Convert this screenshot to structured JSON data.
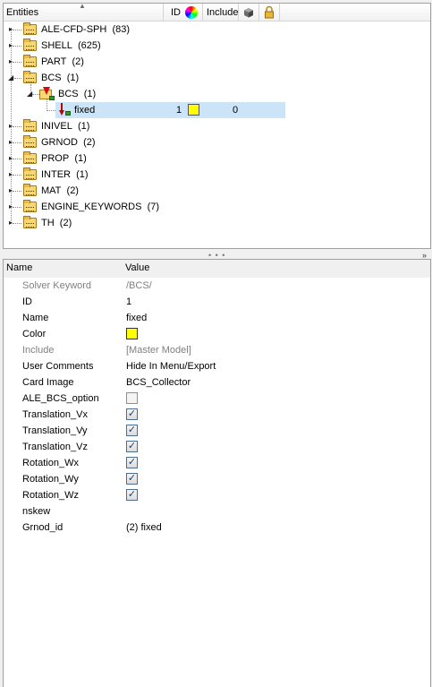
{
  "tree": {
    "columns": {
      "entities": "Entities",
      "id": "ID",
      "include": "Include"
    },
    "color_wheel_icon": "color-wheel-icon",
    "visibility_icon": "cube-icon",
    "lock_icon": "lock-icon",
    "items": [
      {
        "label": "ALE-CFD-SPH",
        "count": "(83)"
      },
      {
        "label": "SHELL",
        "count": "(625)"
      },
      {
        "label": "PART",
        "count": "(2)"
      },
      {
        "label": "BCS",
        "count": "(1)"
      },
      {
        "label": "BCS",
        "count": "(1)"
      },
      {
        "label": "fixed",
        "id": "1",
        "include": "0"
      },
      {
        "label": "INIVEL",
        "count": "(1)"
      },
      {
        "label": "GRNOD",
        "count": "(2)"
      },
      {
        "label": "PROP",
        "count": "(1)"
      },
      {
        "label": "INTER",
        "count": "(1)"
      },
      {
        "label": "MAT",
        "count": "(2)"
      },
      {
        "label": "ENGINE_KEYWORDS",
        "count": "(7)"
      },
      {
        "label": "TH",
        "count": "(2)"
      }
    ],
    "selected_color": "#ffff00"
  },
  "splitter": {
    "dots": "• • •",
    "chevron": "»"
  },
  "props": {
    "name_header": "Name",
    "value_header": "Value",
    "rows": [
      {
        "name": "Solver Keyword",
        "value": "/BCS/"
      },
      {
        "name": "ID",
        "value": "1"
      },
      {
        "name": "Name",
        "value": "fixed"
      },
      {
        "name": "Color",
        "value": "#ffff00"
      },
      {
        "name": "Include",
        "value": "[Master Model]"
      },
      {
        "name": "User Comments",
        "value": "Hide In Menu/Export"
      },
      {
        "name": "Card Image",
        "value": "BCS_Collector"
      },
      {
        "name": "ALE_BCS_option",
        "value": "unchecked"
      },
      {
        "name": "Translation_Vx",
        "value": "checked"
      },
      {
        "name": "Translation_Vy",
        "value": "checked"
      },
      {
        "name": "Translation_Vz",
        "value": "checked"
      },
      {
        "name": "Rotation_Wx",
        "value": "checked"
      },
      {
        "name": "Rotation_Wy",
        "value": "checked"
      },
      {
        "name": "Rotation_Wz",
        "value": "checked"
      },
      {
        "name": "nskew",
        "value": ""
      },
      {
        "name": "Grnod_id",
        "value": "(2) fixed"
      }
    ],
    "check_glyph": "✓"
  }
}
